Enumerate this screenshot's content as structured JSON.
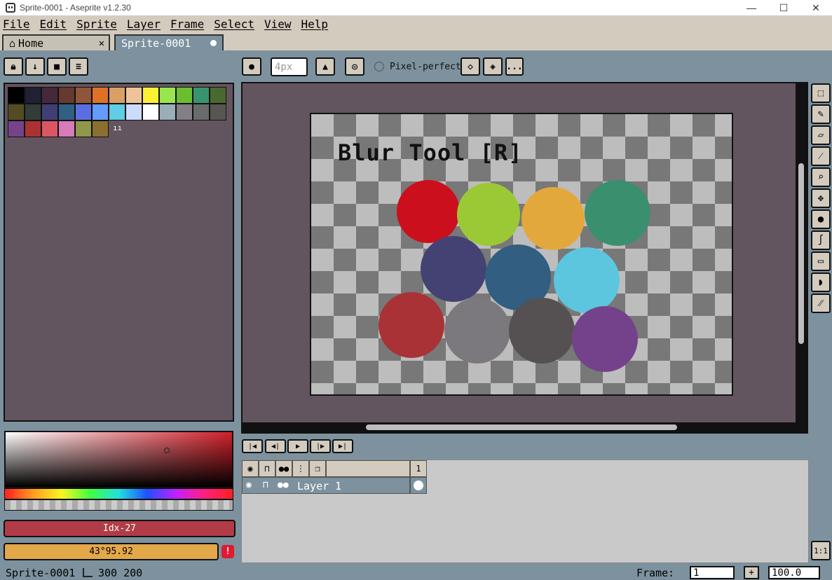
{
  "window": {
    "title": "Sprite-0001 - Aseprite v1.2.30",
    "controls": [
      "—",
      "☐",
      "✕"
    ]
  },
  "menu": [
    "File",
    "Edit",
    "Sprite",
    "Layer",
    "Frame",
    "Select",
    "View",
    "Help"
  ],
  "tabs": {
    "home": {
      "label": "Home",
      "close": "✕"
    },
    "sprite": {
      "label": "Sprite-0001"
    }
  },
  "palette": {
    "swatches": [
      "#000000",
      "#222034",
      "#45283c",
      "#663931",
      "#8f563b",
      "#df7126",
      "#d9a066",
      "#eec39a",
      "#fbf236",
      "#99e550",
      "#6abe30",
      "#37946e",
      "#4b692f",
      "#524b24",
      "#323c39",
      "#3f3f74",
      "#306082",
      "#5b6ee1",
      "#639bff",
      "#5fcde4",
      "#cbdbfc",
      "#ffffff",
      "#9badb7",
      "#847e87",
      "#696a6a",
      "#595652",
      "#76428a",
      "#ac3232",
      "#d95763",
      "#d77bba",
      "#8f974a",
      "#8a6f30"
    ],
    "more": "ıı"
  },
  "color": {
    "index_label": "Idx-27",
    "hsv_label": "43°95.92",
    "warning": "!",
    "foreground": "#b13c47",
    "background": "#e3a84a"
  },
  "context_bar": {
    "brush_size": "4px",
    "pixel_perfect": "Pixel-perfect",
    "more_button": "..."
  },
  "canvas": {
    "text": "Blur Tool [R]",
    "circle_colors": [
      "#cc0f1d",
      "#9bc935",
      "#e3a83c",
      "#3a8f6e",
      "#444272",
      "#315e81",
      "#5dc6df",
      "#a93236",
      "#7b787e",
      "#555152",
      "#74428a"
    ]
  },
  "timeline": {
    "frame_header": "1",
    "layer_name": "Layer 1"
  },
  "status": {
    "sprite_name": "Sprite-0001",
    "size": "300 200",
    "frame_label": "Frame:",
    "frame_value": "1",
    "plus": "+",
    "zoom": "100.0"
  },
  "zoom_fit": "1:1"
}
